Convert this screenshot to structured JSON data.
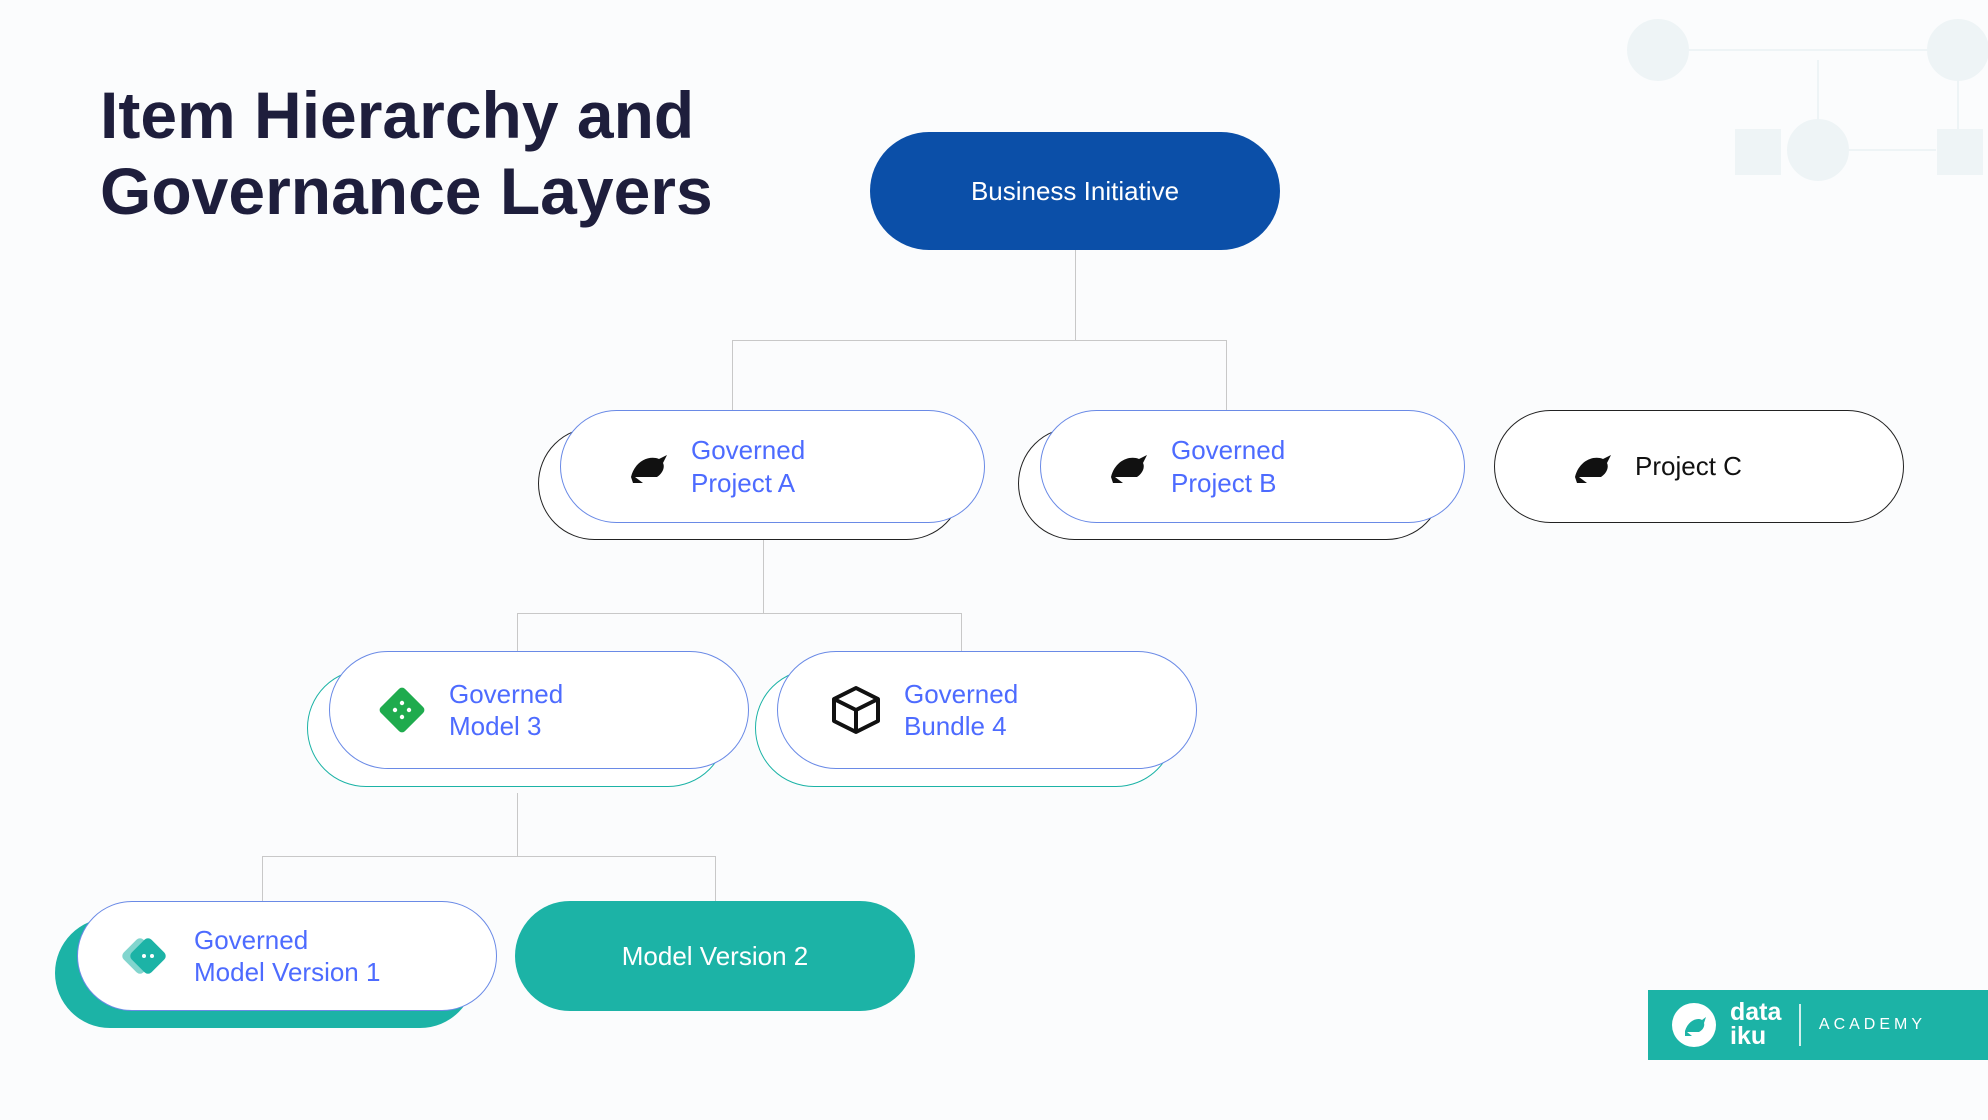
{
  "title_line1": "Item Hierarchy and",
  "title_line2": "Governance Layers",
  "nodes": {
    "root": "Business Initiative",
    "projA": "Governed\nProject A",
    "projB": "Governed\nProject B",
    "projC": "Project C",
    "model3": "Governed\nModel 3",
    "bundle4": "Governed\nBundle 4",
    "mv1": "Governed\nModel Version 1",
    "mv2": "Model Version 2"
  },
  "brand": {
    "name1": "data",
    "name2": "iku",
    "academy": "ACADEMY"
  },
  "colors": {
    "blue": "#0b4fa8",
    "teal": "#1cb3a6",
    "link": "#4d6bff",
    "title": "#1e1e3c",
    "deco": "#e3eef0"
  }
}
